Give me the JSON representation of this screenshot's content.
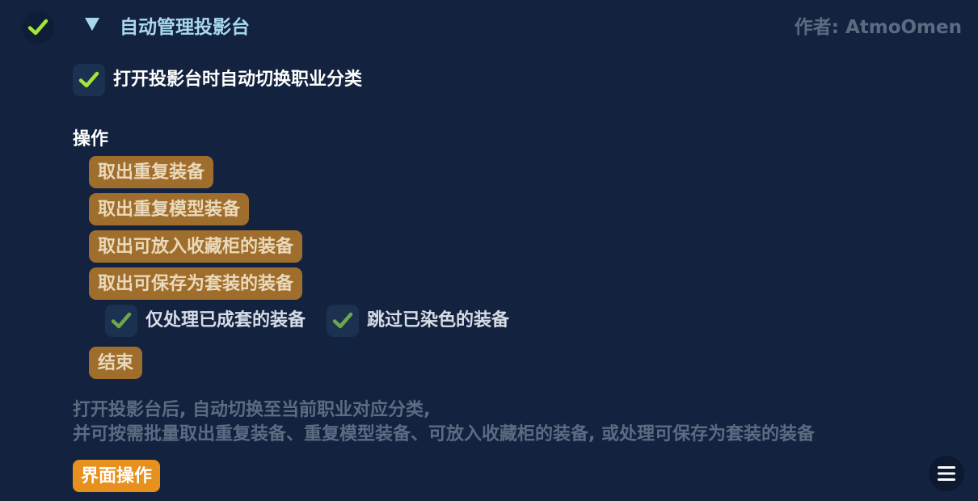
{
  "header": {
    "title": "自动管理投影台",
    "author": "作者: AtmoOmen",
    "enabled": true,
    "expanded": true
  },
  "options": {
    "auto_switch": {
      "label": "打开投影台时自动切换职业分类",
      "checked": true
    }
  },
  "operations": {
    "heading": "操作",
    "buttons": [
      "取出重复装备",
      "取出重复模型装备",
      "取出可放入收藏柜的装备",
      "取出可保存为套装的装备"
    ],
    "sub_options": [
      {
        "label": "仅处理已成套的装备",
        "checked": true
      },
      {
        "label": "跳过已染色的装备",
        "checked": true
      }
    ],
    "end_button": "结束"
  },
  "description": {
    "line1": "打开投影台后, 自动切换至当前职业对应分类,",
    "line2": "并可按需批量取出重复装备、重复模型装备、可放入收藏柜的装备, 或处理可保存为套装的装备"
  },
  "footer": {
    "ui_button": "界面操作",
    "menu_icon": "hamburger-menu-icon"
  },
  "colors": {
    "background": "#13233f",
    "check": "#a3e635",
    "title": "#a9d8ee",
    "action_button": "#a06e2c",
    "ui_button": "#e8901d",
    "muted_text": "#5d6b82"
  }
}
